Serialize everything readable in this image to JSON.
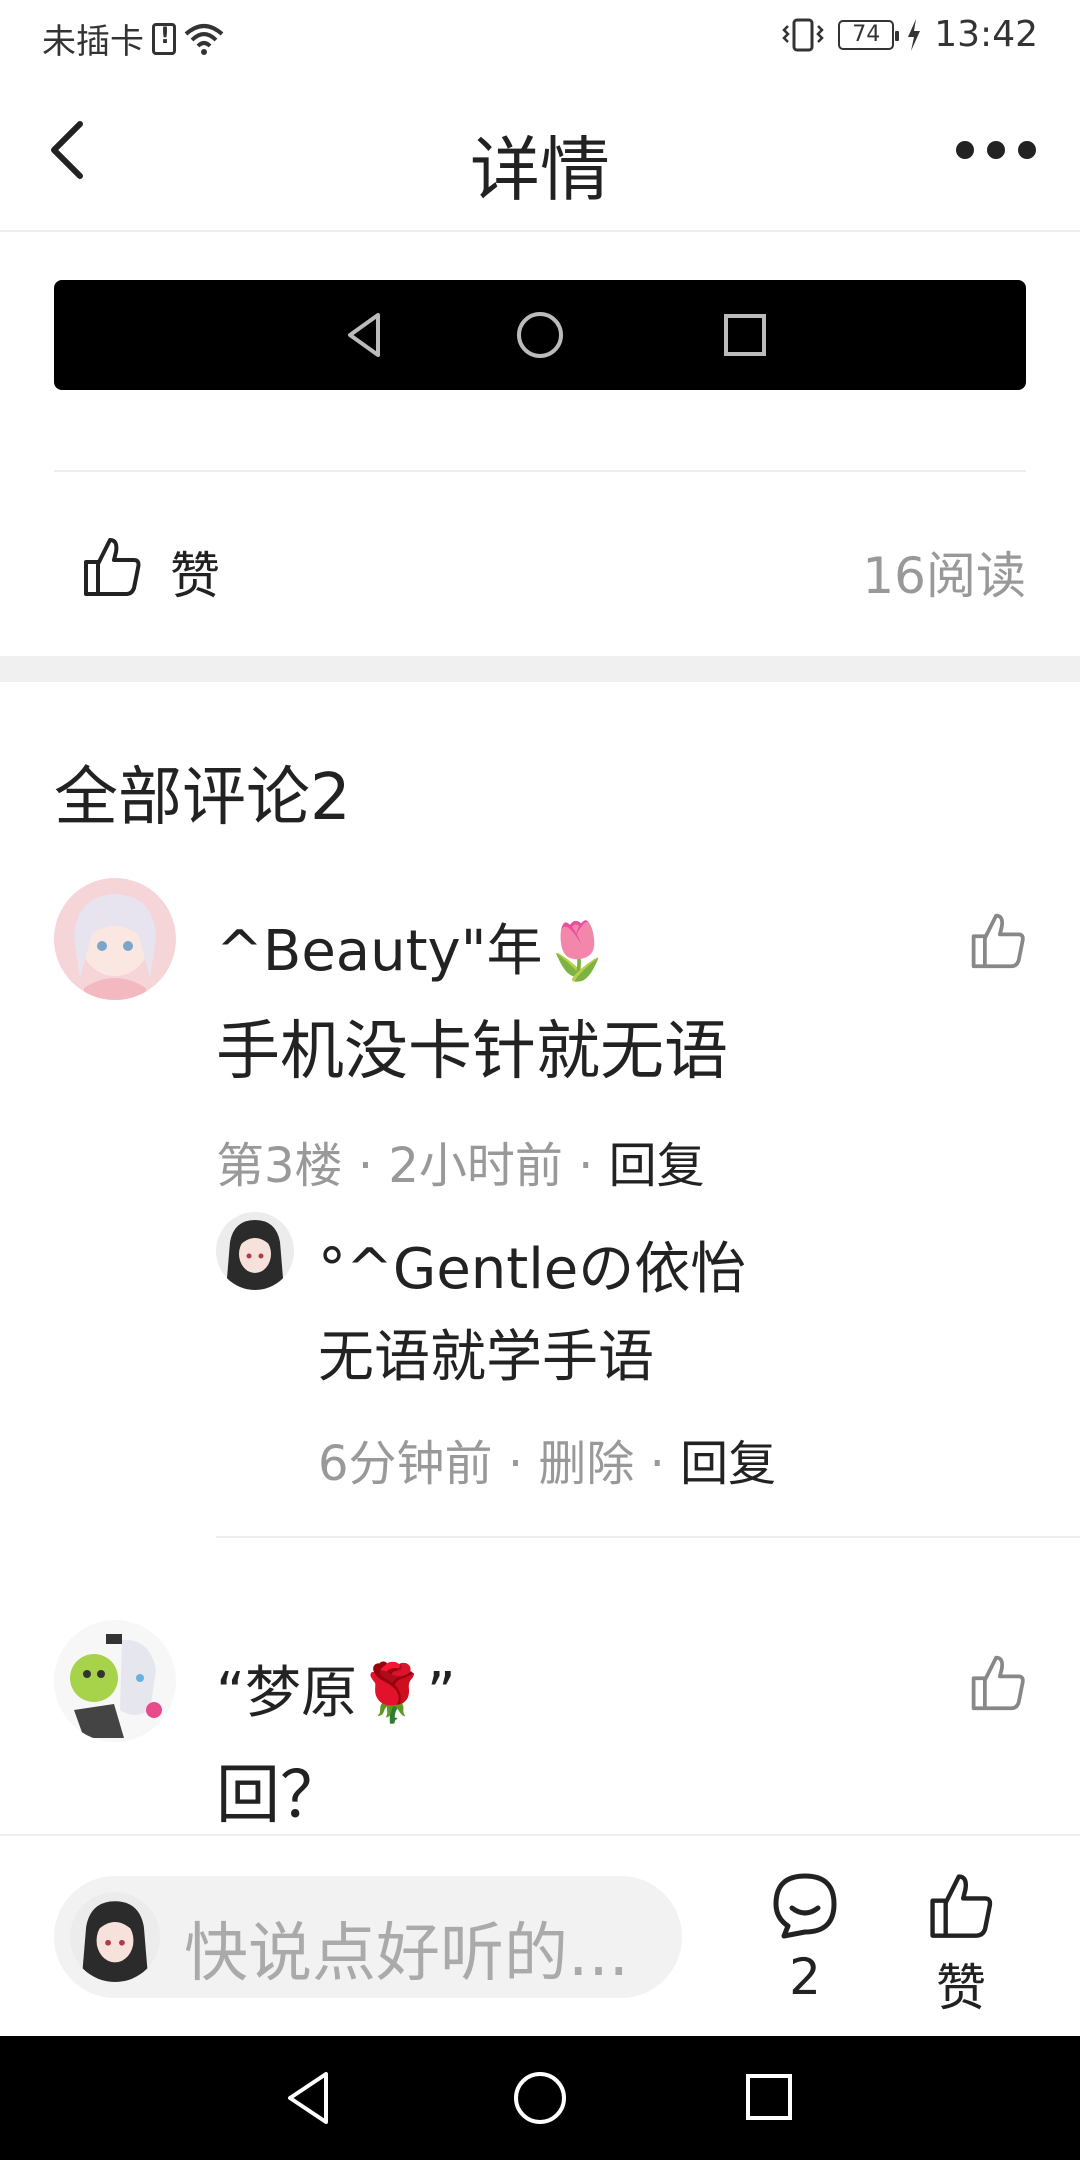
{
  "status": {
    "carrier": "未插卡",
    "battery": "74",
    "time": "13:42"
  },
  "header": {
    "title": "详情"
  },
  "post": {
    "like_label": "赞",
    "read_count": "16阅读"
  },
  "comments_title": "全部评论2",
  "comments": [
    {
      "name": "^Beauty\"年🌷",
      "text": "手机没卡针就无语",
      "floor": "第3楼",
      "time": "2小时前",
      "reply_label": "回复",
      "replies": [
        {
          "name": "°^Gentleの依怡",
          "text": "无语就学手语",
          "time": "6分钟前",
          "delete_label": "删除",
          "reply_label": "回复"
        }
      ]
    },
    {
      "name": "“梦原🌹”",
      "text": "回？"
    }
  ],
  "bottom_bar": {
    "placeholder": "快说点好听的...",
    "comment_count": "2",
    "like_label": "赞"
  },
  "colors": {
    "text": "#222222",
    "muted": "#999999",
    "band": "#f0f0f0"
  }
}
